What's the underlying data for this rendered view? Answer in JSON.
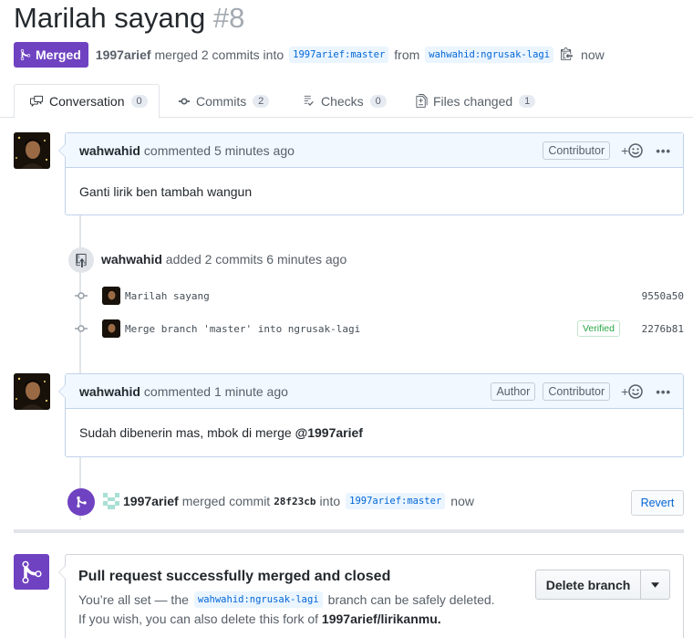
{
  "header": {
    "title": "Marilah sayang",
    "number": "#8",
    "status": "Merged",
    "author": "1997arief",
    "merged_text": "merged 2 commits into",
    "base_branch": "1997arief:master",
    "from_text": "from",
    "head_branch": "wahwahid:ngrusak-lagi",
    "time": "now"
  },
  "tabs": [
    {
      "label": "Conversation",
      "count": "0"
    },
    {
      "label": "Commits",
      "count": "2"
    },
    {
      "label": "Checks",
      "count": "0"
    },
    {
      "label": "Files changed",
      "count": "1"
    }
  ],
  "comment1": {
    "author": "wahwahid",
    "action": "commented 5 minutes ago",
    "role": "Contributor",
    "body": "Ganti lirik ben tambah wangun"
  },
  "commits_event": {
    "author": "wahwahid",
    "action": "added 2 commits 6 minutes ago",
    "commits": [
      {
        "message": "Marilah sayang",
        "sha": "9550a50",
        "verified": ""
      },
      {
        "message": "Merge branch 'master' into ngrusak-lagi",
        "sha": "2276b81",
        "verified": "Verified"
      }
    ]
  },
  "comment2": {
    "author": "wahwahid",
    "action": "commented 1 minute ago",
    "role1": "Author",
    "role2": "Contributor",
    "body_text": "Sudah dibenerin mas, mbok di merge",
    "mention": "@1997arief"
  },
  "merge_event": {
    "author": "1997arief",
    "text": "merged commit",
    "sha": "28f23cb",
    "into": "into",
    "branch": "1997arief:master",
    "time": "now",
    "revert_label": "Revert"
  },
  "merge_box": {
    "title": "Pull request successfully merged and closed",
    "line1_prefix": "You’re all set — the",
    "branch": "wahwahid:ngrusak-lagi",
    "line1_suffix": "branch can be safely deleted.",
    "line2_prefix": "If you wish, you can also delete this fork of",
    "repo": "1997arief/lirikanmu.",
    "delete_label": "Delete branch"
  },
  "colors": {
    "merged": "#6f42c1",
    "link": "#0366d6",
    "comment_header": "#f1f8ff"
  },
  "icons": [
    "merge-icon",
    "conversation-icon",
    "commit-icon",
    "checks-icon",
    "file-diff-icon",
    "copy-icon",
    "smiley-icon",
    "kebab-icon",
    "repo-push-icon",
    "chevron-down-icon"
  ]
}
